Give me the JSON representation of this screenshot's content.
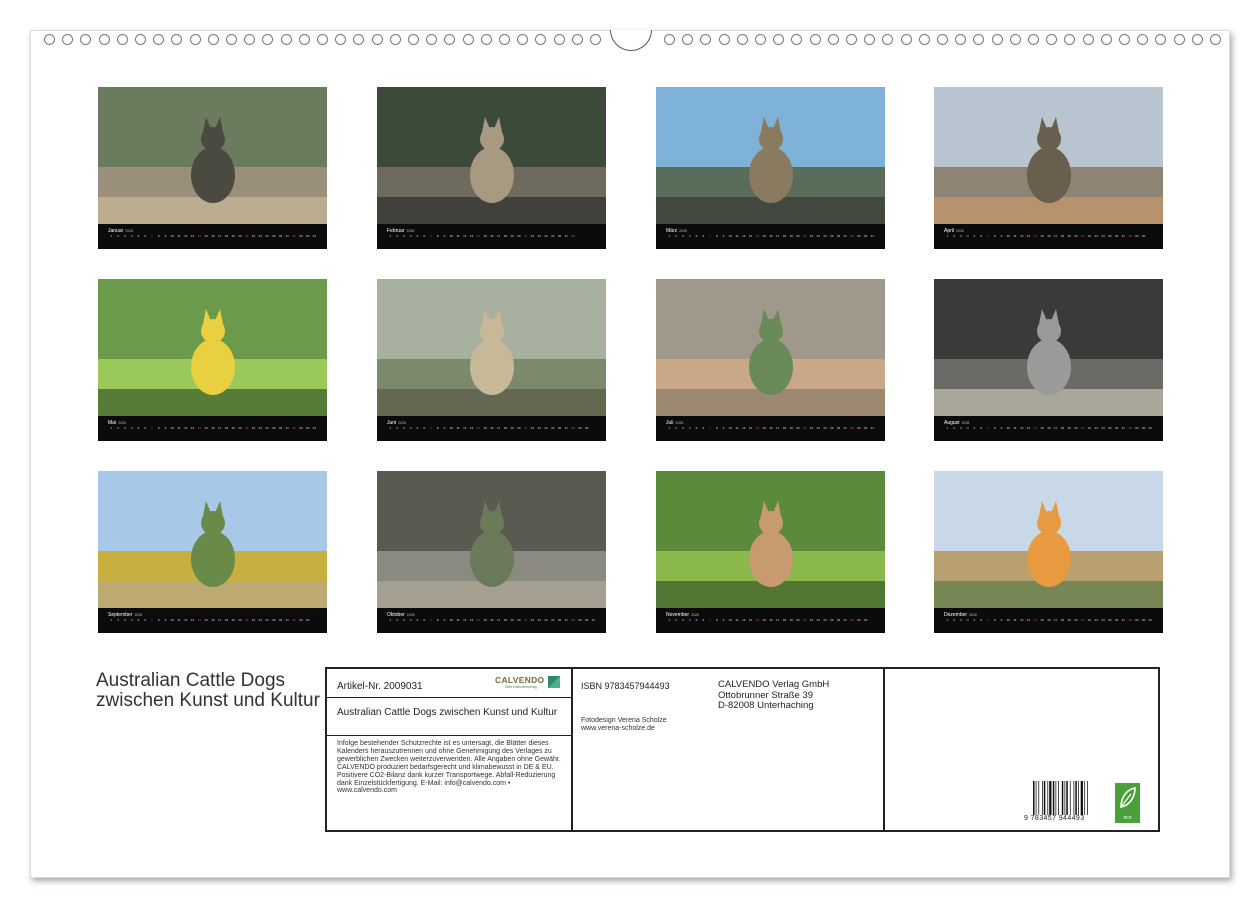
{
  "calendar": {
    "year": "2026",
    "months": [
      {
        "name": "Januar",
        "theme": "five-dogs-wall"
      },
      {
        "name": "Februar",
        "theme": "two-dogs-columns"
      },
      {
        "name": "März",
        "theme": "two-dogs-chapel"
      },
      {
        "name": "April",
        "theme": "dog-on-statue"
      },
      {
        "name": "Mai",
        "theme": "dog-meadow"
      },
      {
        "name": "Juni",
        "theme": "dogs-avenue"
      },
      {
        "name": "Juli",
        "theme": "dog-tree"
      },
      {
        "name": "August",
        "theme": "two-dogs-columns-2"
      },
      {
        "name": "September",
        "theme": "dog-park"
      },
      {
        "name": "Oktober",
        "theme": "dogs-fountain"
      },
      {
        "name": "November",
        "theme": "dog-moss"
      },
      {
        "name": "Dezember",
        "theme": "dog-chapel"
      }
    ]
  },
  "back_cover": {
    "title": "Australian Cattle Dogs zwischen Kunst und Kultur",
    "article_number": "Artikel-Nr. 2009031",
    "logo": "CALVENDO",
    "logo_sub": "Dein Kalenderverlag",
    "subtitle": "Australian Cattle Dogs zwischen Kunst und Kultur",
    "legal": "Infolge bestehender Schutzrechte ist es untersagt, die Blätter dieses Kalenders herauszutrennen und ohne Genehmigung des Verlages zu gewerblichen Zwecken weiterzuverwenden. Alle Angaben ohne Gewähr. CALVENDO produziert bedarfsgerecht und klimabewusst in DE & EU. Positivere CO2-Bilanz dank kurzer Transportwege. Abfall-Reduzierung dank Einzelstückfertigung. E-Mail: info@calvendo.com • www.calvendo.com",
    "isbn": "ISBN 9783457944493",
    "photo_credit_1": "Fotodesign Verena Scholze",
    "photo_credit_2": "www.verena-scholze.de",
    "publisher_1": "CALVENDO Verlag GmbH",
    "publisher_2": "Ottobrunner Straße 39",
    "publisher_3": "D-82008 Unterhaching",
    "barcode_number": "9 783457 944493",
    "eco_label": "eco"
  }
}
